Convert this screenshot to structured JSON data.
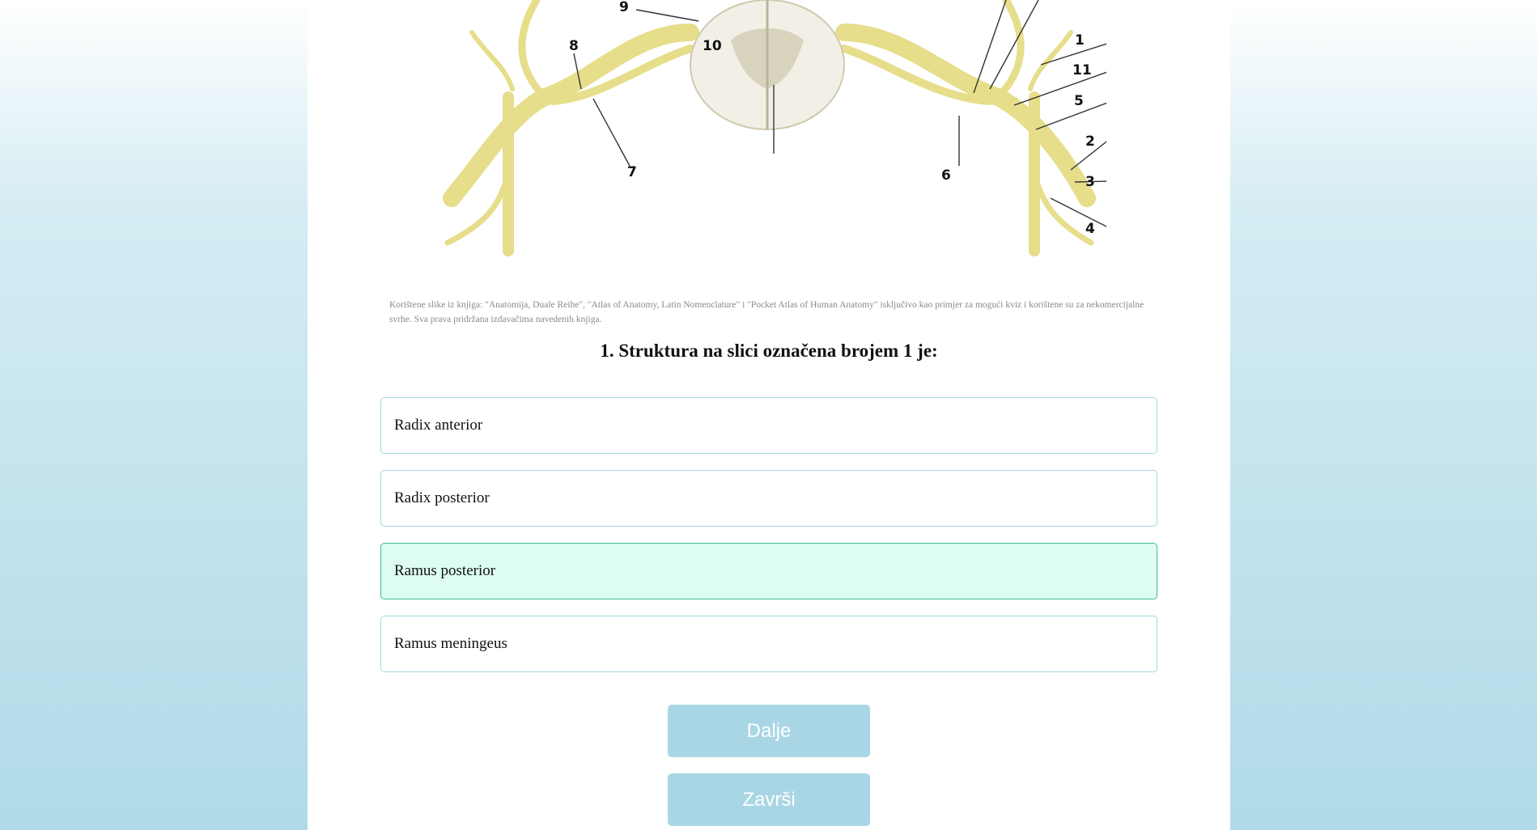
{
  "figure": {
    "alt": "Spinal cord and spinal nerve diagram",
    "labels": [
      "1",
      "2",
      "3",
      "4",
      "5",
      "6",
      "7",
      "8",
      "9",
      "10",
      "11"
    ]
  },
  "credit": "Korištene slike iz knjiga: \"Anatomija, Duale Reihe\", \"Atlas of Anatomy, Latin Nomenclature\" i \"Pocket Atlas of Human Anatomy\" isključivo kao primjer za mogući kviz i korištene su za nekomercijalne svrhe. Sva prava pridržana izdavačima navedenih knjiga.",
  "question": "1. Struktura na slici označena brojem 1 je:",
  "options": [
    {
      "label": "Radix anterior",
      "selected": false
    },
    {
      "label": "Radix posterior",
      "selected": false
    },
    {
      "label": "Ramus posterior",
      "selected": true
    },
    {
      "label": "Ramus meningeus",
      "selected": false
    }
  ],
  "buttons": {
    "next": "Dalje",
    "finish": "Završi"
  },
  "colors": {
    "nerve": "#e6de8a",
    "selected_bg": "#dcfdf0",
    "selected_border": "#3cc08e",
    "button": "#a9d6e4"
  }
}
